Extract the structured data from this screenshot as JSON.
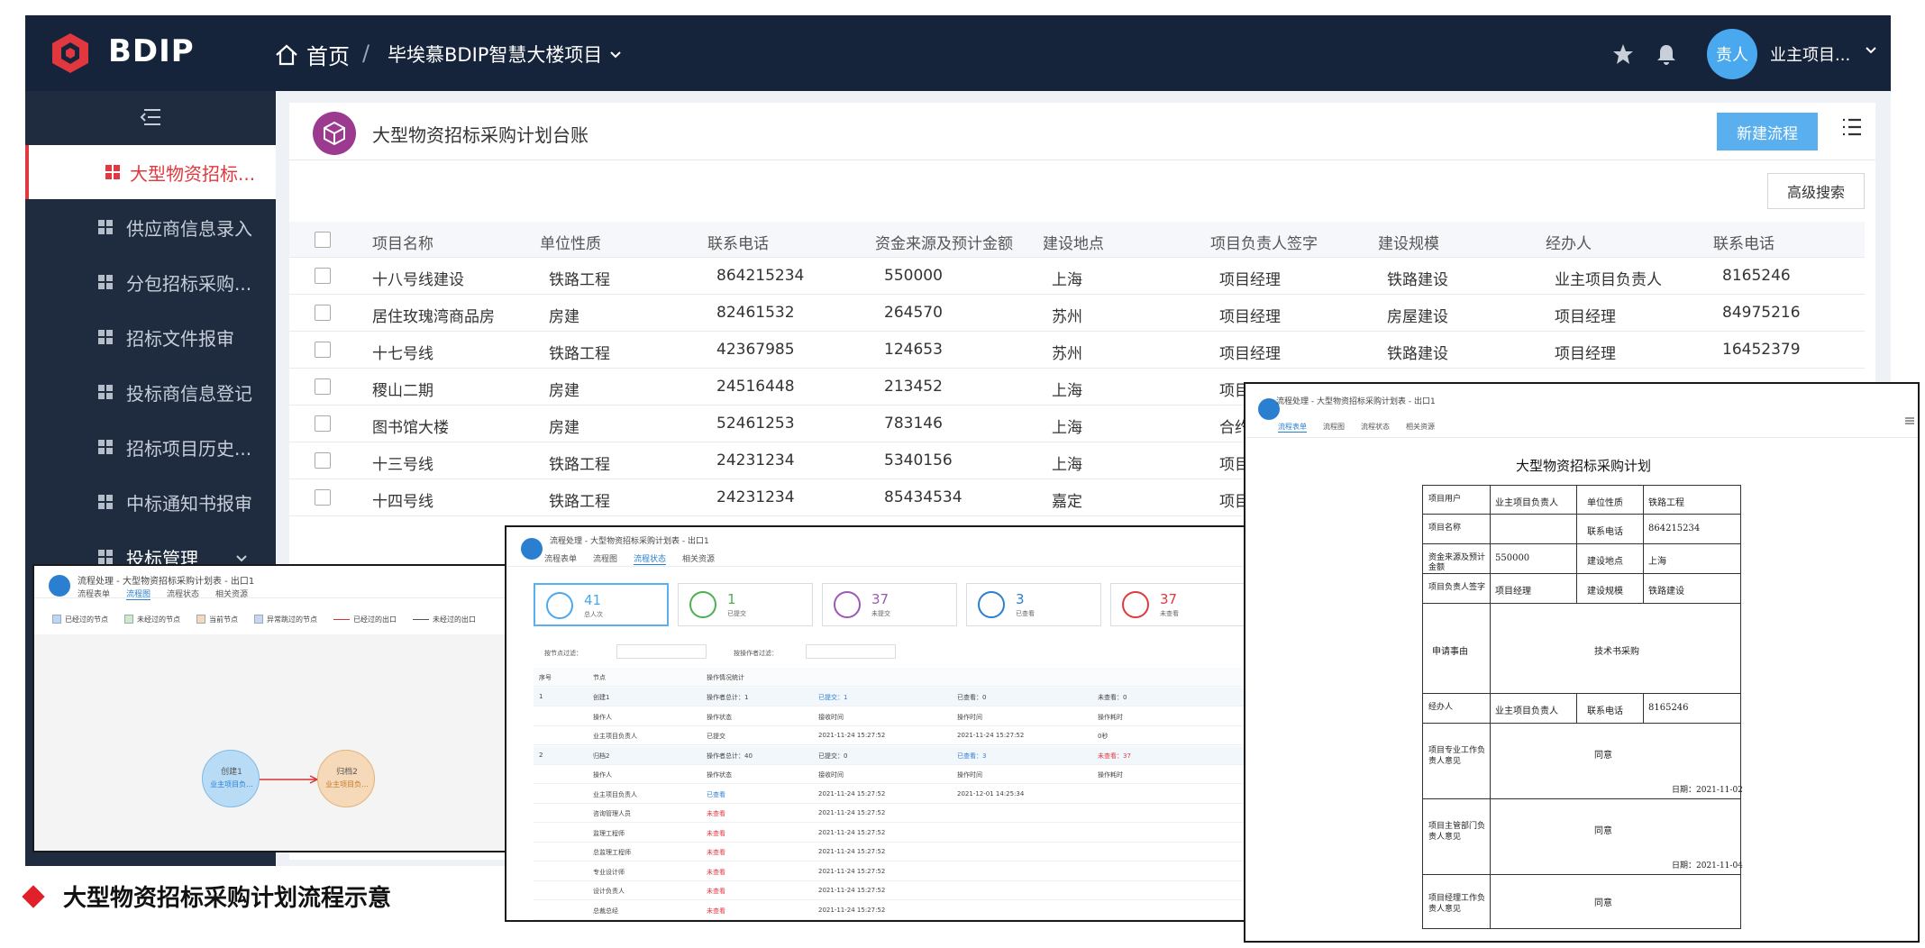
{
  "topbar": {
    "logo_text": "BDIP",
    "home_label": "首页",
    "breadcrumb_separator": "/",
    "project_name": "毕埃慕BDIP智慧大楼项目",
    "avatar_text": "责人",
    "username": "业主项目..."
  },
  "sidebar": {
    "items": [
      {
        "label": "大型物资招标...",
        "active": true
      },
      {
        "label": "供应商信息录入"
      },
      {
        "label": "分包招标采购..."
      },
      {
        "label": "招标文件报审"
      },
      {
        "label": "投标商信息登记"
      },
      {
        "label": "招标项目历史..."
      },
      {
        "label": "中标通知书报审"
      },
      {
        "label": "投标管理",
        "group": true
      }
    ]
  },
  "main": {
    "title": "大型物资招标采购计划台账",
    "new_button": "新建流程",
    "adv_search": "高级搜索",
    "columns": [
      "项目名称",
      "单位性质",
      "联系电话",
      "资金来源及预计金额",
      "建设地点",
      "项目负责人签字",
      "建设规模",
      "经办人",
      "联系电话"
    ],
    "rows": [
      [
        "十八号线建设",
        "铁路工程",
        "864215234",
        "550000",
        "上海",
        "项目经理",
        "铁路建设",
        "业主项目负责人",
        "8165246"
      ],
      [
        "居住玫瑰湾商品房",
        "房建",
        "82461532",
        "264570",
        "苏州",
        "项目经理",
        "房屋建设",
        "项目经理",
        "84975216"
      ],
      [
        "十七号线",
        "铁路工程",
        "42367985",
        "124653",
        "苏州",
        "项目经理",
        "铁路建设",
        "项目经理",
        "16452379"
      ],
      [
        "稷山二期",
        "房建",
        "24516448",
        "213452",
        "上海",
        "项目",
        "",
        "",
        ""
      ],
      [
        "图书馆大楼",
        "房建",
        "52461253",
        "783146",
        "上海",
        "合约",
        "",
        "",
        ""
      ],
      [
        "十三号线",
        "铁路工程",
        "24231234",
        "5340156",
        "上海",
        "项目",
        "",
        "",
        ""
      ],
      [
        "十四号线",
        "铁路工程",
        "24231234",
        "85434534",
        "嘉定",
        "项目",
        "",
        "",
        ""
      ]
    ]
  },
  "overlay_left": {
    "title": "流程处理 - 大型物资招标采购计划表 - 出口1",
    "tabs": [
      "流程表单",
      "流程图",
      "流程状态",
      "相关资源"
    ],
    "active_tab": 1,
    "legend": [
      "已经过的节点",
      "未经过的节点",
      "当前节点",
      "异常跳过的节点",
      "已经过的出口",
      "未经过的出口"
    ],
    "legend_colors": [
      "#bcd6f4",
      "#cfe8c6",
      "#f6d9b8",
      "#c9d6f0",
      "#d83333",
      "#555555"
    ],
    "node1_title": "创建1",
    "node1_sub": "业主项目负...",
    "node2_title": "归档2",
    "node2_sub": "业主项目负..."
  },
  "overlay_mid": {
    "title": "流程处理 - 大型物资招标采购计划表 - 出口1",
    "tabs": [
      "流程表单",
      "流程图",
      "流程状态",
      "相关资源"
    ],
    "active_tab": 2,
    "stats": [
      {
        "num": "41",
        "label": "总人次",
        "color": "#4aa8ef"
      },
      {
        "num": "1",
        "label": "已提交",
        "color": "#4caf50"
      },
      {
        "num": "37",
        "label": "未提交",
        "color": "#9b59b6"
      },
      {
        "num": "3",
        "label": "已查看",
        "color": "#2a7fd1"
      },
      {
        "num": "37",
        "label": "未查看",
        "color": "#e0383e"
      }
    ],
    "filter1": "按节点过滤：",
    "filter2": "按操作者过滤：",
    "headers": [
      "序号",
      "节点",
      "操作情况统计"
    ],
    "rows": [
      {
        "a": "1",
        "b": "创建1",
        "c": "操作者总计：1",
        "d": "已提交：1",
        "e": "已查看：0",
        "f": "未查看：0",
        "shade": true
      },
      {
        "a": "",
        "b": "操作人",
        "c": "操作状态",
        "d": "接收时间",
        "e": "操作时间",
        "f": "操作耗时"
      },
      {
        "a": "",
        "b": "业主项目负责人",
        "c": "已提交",
        "d": "2021-11-24 15:27:52",
        "e": "2021-11-24 15:27:52",
        "f": "0秒"
      },
      {
        "a": "2",
        "b": "归档2",
        "c": "操作者总计：40",
        "d": "已提交：0",
        "e": "已查看：3",
        "f": "未查看：37",
        "shade": true
      },
      {
        "a": "",
        "b": "操作人",
        "c": "操作状态",
        "d": "接收时间",
        "e": "操作时间",
        "f": "操作耗时"
      },
      {
        "a": "",
        "b": "业主项目负责人",
        "c": "已查看",
        "d": "2021-11-24 15:27:52",
        "e": "2021-12-01 14:25:34",
        "f": ""
      },
      {
        "a": "",
        "b": "咨询管理人员",
        "c": "未查看",
        "d": "2021-11-24 15:27:52",
        "e": "",
        "f": ""
      },
      {
        "a": "",
        "b": "监理工程师",
        "c": "未查看",
        "d": "2021-11-24 15:27:52",
        "e": "",
        "f": ""
      },
      {
        "a": "",
        "b": "总监理工程师",
        "c": "未查看",
        "d": "2021-11-24 15:27:52",
        "e": "",
        "f": ""
      },
      {
        "a": "",
        "b": "专业设计师",
        "c": "未查看",
        "d": "2021-11-24 15:27:52",
        "e": "",
        "f": ""
      },
      {
        "a": "",
        "b": "设计负责人",
        "c": "未查看",
        "d": "2021-11-24 15:27:52",
        "e": "",
        "f": ""
      },
      {
        "a": "",
        "b": "总裁总经",
        "c": "未查看",
        "d": "2021-11-24 15:27:52",
        "e": "",
        "f": ""
      }
    ]
  },
  "overlay_right": {
    "title": "流程处理 - 大型物资招标采购计划表 - 出口1",
    "tabs": [
      "流程表单",
      "流程图",
      "流程状态",
      "相关资源"
    ],
    "active_tab": 0,
    "form_title": "大型物资招标采购计划",
    "r1": [
      "项目用户",
      "业主项目负责人",
      "单位性质",
      "铁路工程"
    ],
    "r2": [
      "项目名称",
      "",
      "联系电话",
      "864215234"
    ],
    "r3": [
      "资金来源及预计金额",
      "550000",
      "建设地点",
      "上海"
    ],
    "r4": [
      "项目负责人签字",
      "项目经理",
      "建设规模",
      "铁路建设"
    ],
    "r5": [
      "申请事由",
      "技术书采购"
    ],
    "r6": [
      "经办人",
      "业主项目负责人",
      "联系电话",
      "8165246"
    ],
    "r7": [
      "项目专业工作负责人意见",
      "同意",
      "日期：2021-11-02"
    ],
    "r8": [
      "项目主管部门负责人意见",
      "同意",
      "日期：2021-11-04"
    ],
    "r9": [
      "项目经理工作负责人意见",
      "同意"
    ]
  },
  "caption": "大型物资招标采购计划流程示意"
}
